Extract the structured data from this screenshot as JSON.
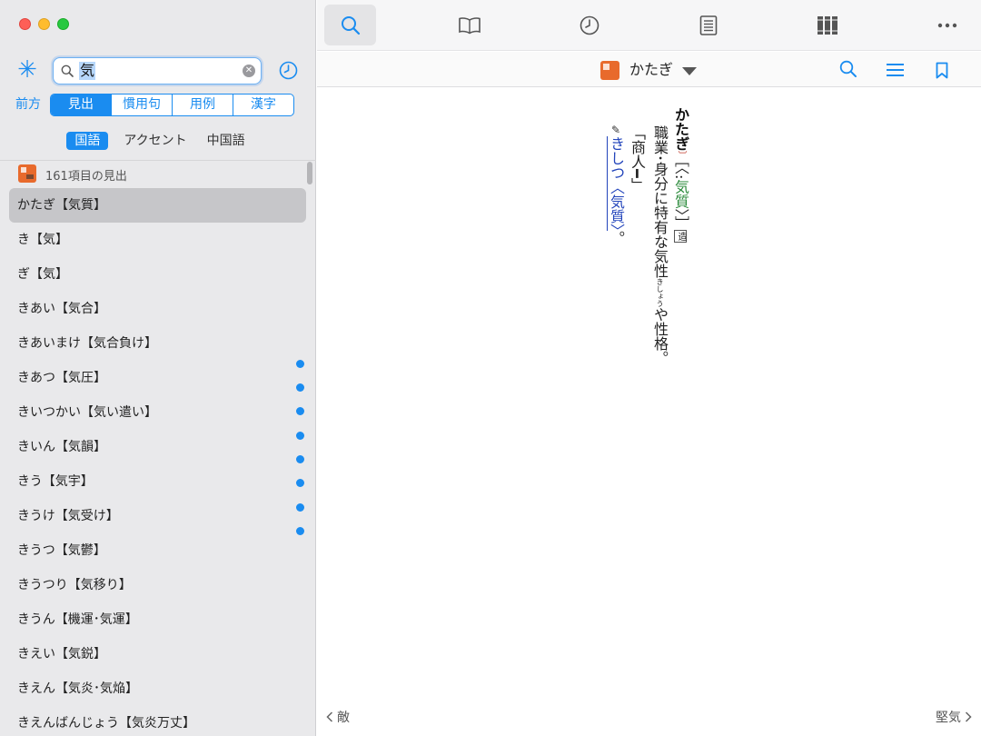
{
  "search": {
    "query": "気"
  },
  "search_modes": {
    "match_label": "前方",
    "tabs": [
      {
        "label": "見出",
        "active": true
      },
      {
        "label": "慣用句",
        "active": false
      },
      {
        "label": "用例",
        "active": false
      },
      {
        "label": "漢字",
        "active": false
      }
    ]
  },
  "dict_tabs": [
    {
      "label": "国語",
      "active": true
    },
    {
      "label": "アクセント",
      "active": false
    },
    {
      "label": "中国語",
      "active": false
    }
  ],
  "results": {
    "count_label": "161項目の見出",
    "items": [
      "かたぎ【気質】",
      "き【気】",
      "ぎ【気】",
      "きあい【気合】",
      "きあいまけ【気合負け】",
      "きあつ【気圧】",
      "きいつかい【気い遣い】",
      "きいん【気韻】",
      "きう【気宇】",
      "きうけ【気受け】",
      "きうつ【気鬱】",
      "きうつり【気移り】",
      "きうん【機運･気運】",
      "きえい【気鋭】",
      "きえん【気炎･気焔】",
      "きえんばんじょう【気炎万丈】"
    ],
    "selected_index": 0
  },
  "header": {
    "title": "かたぎ"
  },
  "entry": {
    "word": "かたぎ",
    "accent_mark": "〕",
    "kanji_open": "［",
    "kanji_paren": "〈:",
    "kanji": "気質",
    "kanji_close": "〉］",
    "tag": "造",
    "definition_a": "職業･身分に特有な気性",
    "ruby": "きしょう",
    "definition_b": "や性格。",
    "example": "「商人━」",
    "ref_mark": "✎",
    "reference": "きしつ〈気質〉",
    "ref_end": "。"
  },
  "footer": {
    "prev": "敵",
    "next": "堅気"
  },
  "colors": {
    "accent": "#1a8cf0",
    "dict_icon": "#e86a2c",
    "sidebar_bg": "#e9e9eb"
  }
}
